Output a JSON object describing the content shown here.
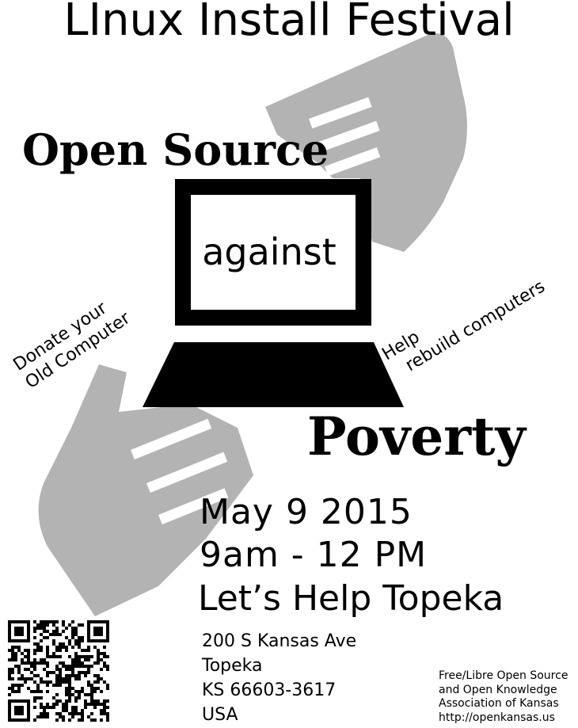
{
  "poster": {
    "title": "LInux Install Festival",
    "headline_top": "Open Source",
    "screen_word": "against",
    "headline_bottom": "Poverty",
    "donate_lines": [
      "Donate your",
      "Old Computer"
    ],
    "help_lines": [
      "Help",
      "rebuild computers"
    ],
    "date": "May 9 2015",
    "time": "9am - 12 PM",
    "venue": "Let’s Help Topeka",
    "address_lines": [
      "200 S Kansas Ave",
      "Topeka",
      "KS 66603-3617",
      "USA"
    ],
    "org_lines": [
      "Free/Libre Open Source",
      "and Open Knowledge",
      "Association of Kansas",
      "http://openkansas.us"
    ]
  },
  "colors": {
    "hand": "#b3b3b3",
    "ink": "#000000",
    "paper": "#ffffff"
  },
  "icons": [
    "hand-top-right-icon",
    "hand-bottom-left-icon",
    "laptop-icon",
    "qr-code-icon"
  ]
}
